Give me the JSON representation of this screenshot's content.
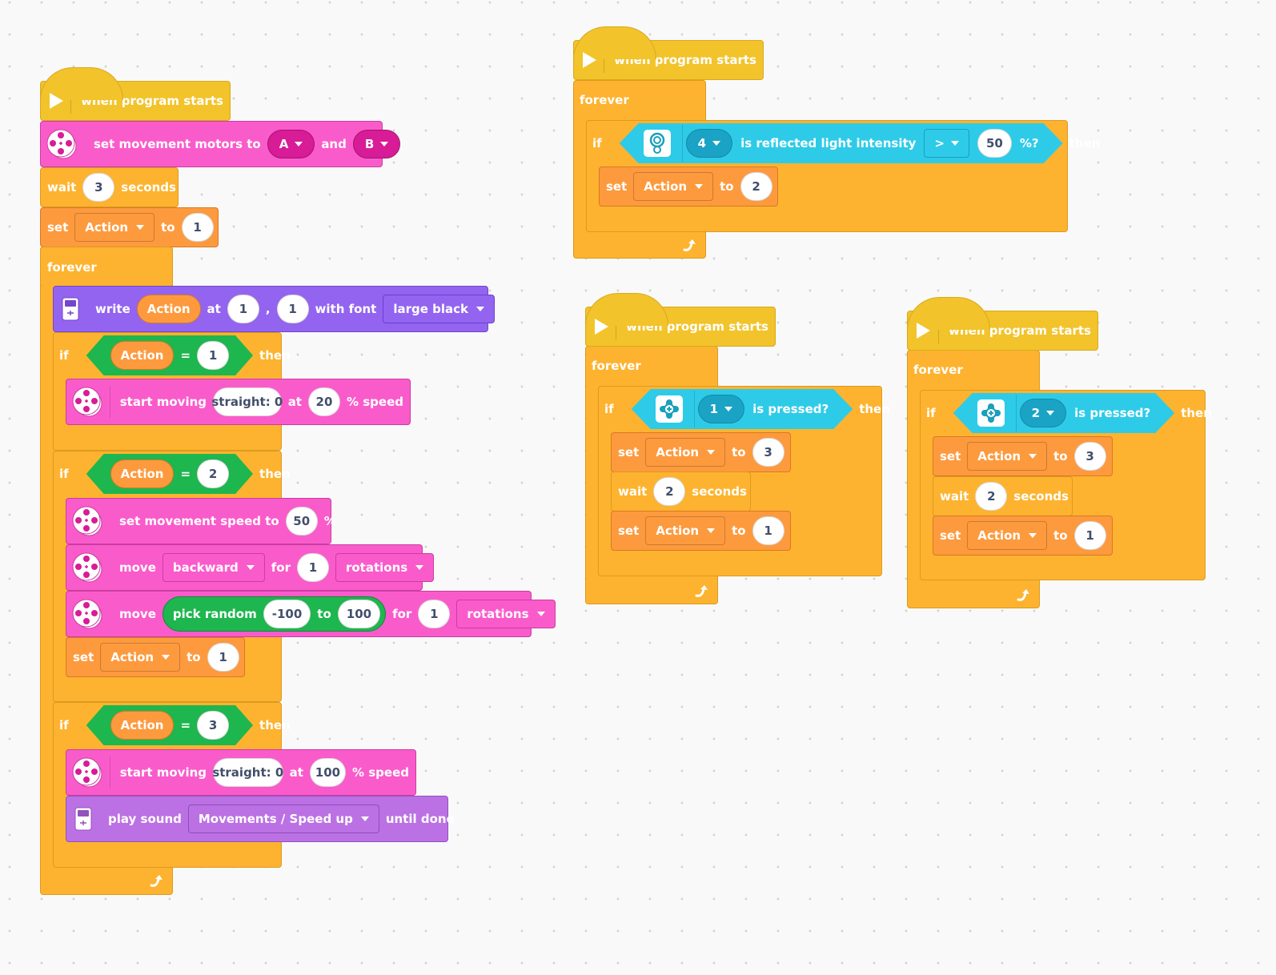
{
  "stacks": {
    "main": {
      "hat_label": "when program starts",
      "set_motors": {
        "label": "set movement motors to",
        "port1": "A",
        "and": "and",
        "port2": "B"
      },
      "wait": {
        "label": "wait",
        "value": "3",
        "unit": "seconds"
      },
      "set_var1": {
        "label": "set",
        "var": "Action",
        "to": "to",
        "value": "1"
      },
      "forever_label": "forever",
      "write": {
        "label": "write",
        "var": "Action",
        "at": "at",
        "x": "1",
        "comma": ",",
        "y": "1",
        "with_font": "with font",
        "font": "large black"
      },
      "if1": {
        "if": "if",
        "var": "Action",
        "op": "=",
        "value": "1",
        "then": "then"
      },
      "start1": {
        "label": "start moving",
        "steer": "straight: 0",
        "at": "at",
        "speed": "20",
        "unit": "% speed"
      },
      "if2": {
        "if": "if",
        "var": "Action",
        "op": "=",
        "value": "2",
        "then": "then"
      },
      "setspeed": {
        "label": "set movement speed to",
        "value": "50",
        "unit": "%"
      },
      "move1": {
        "label": "move",
        "dir": "backward",
        "for": "for",
        "amount": "1",
        "unit": "rotations"
      },
      "move2": {
        "label": "move",
        "rand_label": "pick random",
        "rand_min": "-100",
        "rand_to": "to",
        "rand_max": "100",
        "for": "for",
        "amount": "1",
        "unit": "rotations"
      },
      "set_var2": {
        "label": "set",
        "var": "Action",
        "to": "to",
        "value": "1"
      },
      "if3": {
        "if": "if",
        "var": "Action",
        "op": "=",
        "value": "3",
        "then": "then"
      },
      "start2": {
        "label": "start moving",
        "steer": "straight: 0",
        "at": "at",
        "speed": "100",
        "unit": "% speed"
      },
      "sound": {
        "label": "play sound",
        "sound": "Movements / Speed up",
        "until": "until done"
      }
    },
    "light": {
      "hat_label": "when program starts",
      "forever_label": "forever",
      "if": "if",
      "port": "4",
      "cond_label": "is reflected light intensity",
      "cmp": ">",
      "value": "50",
      "unit": "%?",
      "then": "then",
      "set": {
        "label": "set",
        "var": "Action",
        "to": "to",
        "value": "2"
      }
    },
    "btn1": {
      "hat_label": "when program starts",
      "forever_label": "forever",
      "if": "if",
      "port": "1",
      "cond_label": "is pressed?",
      "then": "then",
      "set_a": {
        "label": "set",
        "var": "Action",
        "to": "to",
        "value": "3"
      },
      "wait": {
        "label": "wait",
        "value": "2",
        "unit": "seconds"
      },
      "set_b": {
        "label": "set",
        "var": "Action",
        "to": "to",
        "value": "1"
      }
    },
    "btn2": {
      "hat_label": "when program starts",
      "forever_label": "forever",
      "if": "if",
      "port": "2",
      "cond_label": "is pressed?",
      "then": "then",
      "set_a": {
        "label": "set",
        "var": "Action",
        "to": "to",
        "value": "3"
      },
      "wait": {
        "label": "wait",
        "value": "2",
        "unit": "seconds"
      },
      "set_b": {
        "label": "set",
        "var": "Action",
        "to": "to",
        "value": "1"
      }
    }
  },
  "icons": {
    "play": "play-icon",
    "motor": "movement-motor-icon",
    "hub": "hub-display-icon",
    "light": "color-sensor-icon",
    "button": "force-sensor-icon",
    "loop": "loop-arrow-icon"
  }
}
